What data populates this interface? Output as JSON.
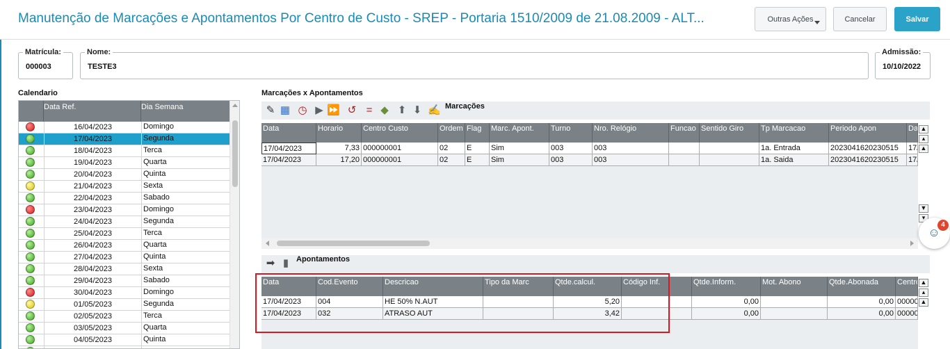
{
  "header": {
    "title": "Manutenção de Marcações e Apontamentos Por Centro de Custo - SREP - Portaria 1510/2009 de 21.08.2009 - ALT...",
    "actions": {
      "outras": "Outras Ações",
      "cancelar": "Cancelar",
      "salvar": "Salvar"
    }
  },
  "form": {
    "matricula": {
      "label": "Matrícula:",
      "value": "000003"
    },
    "nome": {
      "label": "Nome:",
      "value": "TESTE3"
    },
    "admissao": {
      "label": "Admissão:",
      "value": "10/10/2022"
    }
  },
  "calendario": {
    "title": "Calendario",
    "columns": [
      "Data Ref.",
      "Dia Semana"
    ],
    "rows": [
      {
        "status": "red",
        "date": "16/04/2023",
        "day": "Domingo"
      },
      {
        "status": "green",
        "date": "17/04/2023",
        "day": "Segunda",
        "selected": true
      },
      {
        "status": "green",
        "date": "18/04/2023",
        "day": "Terca"
      },
      {
        "status": "green",
        "date": "19/04/2023",
        "day": "Quarta"
      },
      {
        "status": "green",
        "date": "20/04/2023",
        "day": "Quinta"
      },
      {
        "status": "yellow",
        "date": "21/04/2023",
        "day": "Sexta"
      },
      {
        "status": "green",
        "date": "22/04/2023",
        "day": "Sabado"
      },
      {
        "status": "red",
        "date": "23/04/2023",
        "day": "Domingo"
      },
      {
        "status": "green",
        "date": "24/04/2023",
        "day": "Segunda"
      },
      {
        "status": "green",
        "date": "25/04/2023",
        "day": "Terca"
      },
      {
        "status": "green",
        "date": "26/04/2023",
        "day": "Quarta"
      },
      {
        "status": "green",
        "date": "27/04/2023",
        "day": "Quinta"
      },
      {
        "status": "green",
        "date": "28/04/2023",
        "day": "Sexta"
      },
      {
        "status": "green",
        "date": "29/04/2023",
        "day": "Sabado"
      },
      {
        "status": "red",
        "date": "30/04/2023",
        "day": "Domingo"
      },
      {
        "status": "yellow",
        "date": "01/05/2023",
        "day": "Segunda"
      },
      {
        "status": "green",
        "date": "02/05/2023",
        "day": "Terca"
      },
      {
        "status": "green",
        "date": "03/05/2023",
        "day": "Quarta"
      },
      {
        "status": "green",
        "date": "04/05/2023",
        "day": "Quinta"
      },
      {
        "status": "green",
        "date": "",
        "day": ""
      }
    ]
  },
  "marcacoes_apont": {
    "title": "Marcações x Apontamentos"
  },
  "marcacoes": {
    "toolbar_label": "Marcações",
    "columns": [
      "Data",
      "Horario",
      "Centro Custo",
      "Ordem",
      "Flag",
      "Marc. Apont.",
      "Turno",
      "Nro. Relógio",
      "Funcao",
      "Sentido Giro",
      "Tp Marcacao",
      "Periodo Apon",
      "Da"
    ],
    "rows": [
      [
        "17/04/2023",
        "7,33",
        "000000001",
        "02",
        "E",
        "Sim",
        "003",
        "003",
        "",
        "",
        "1a. Entrada",
        "2023041620230515",
        "17/"
      ],
      [
        "17/04/2023",
        "17,20",
        "000000001",
        "02",
        "E",
        "Sim",
        "003",
        "003",
        "",
        "",
        "1a. Saida",
        "2023041620230515",
        "17/"
      ]
    ]
  },
  "apontamentos": {
    "toolbar_label": "Apontamentos",
    "columns": [
      "Data",
      "Cod.Evento",
      "Descricao",
      "Tipo da Marc",
      "Qtde.calcul.",
      "Código Inf.",
      "Qtde.Inform.",
      "Mot. Abono",
      "Qtde.Abonada",
      "Centro"
    ],
    "rows": [
      [
        "17/04/2023",
        "004",
        "HE 50% N.AUT",
        "",
        "5,20",
        "",
        "0,00",
        "",
        "0,00",
        "00000"
      ],
      [
        "17/04/2023",
        "032",
        "ATRASO AUT",
        "",
        "3,42",
        "",
        "0,00",
        "",
        "0,00",
        "00000"
      ]
    ]
  },
  "chat": {
    "badge": "4"
  },
  "colors": {
    "accent": "#1b8ab4",
    "primary_button": "#2ba3c9",
    "grid_header": "#7b8287",
    "selected_row": "#1f9fcc",
    "highlight_box": "#e0141e"
  }
}
